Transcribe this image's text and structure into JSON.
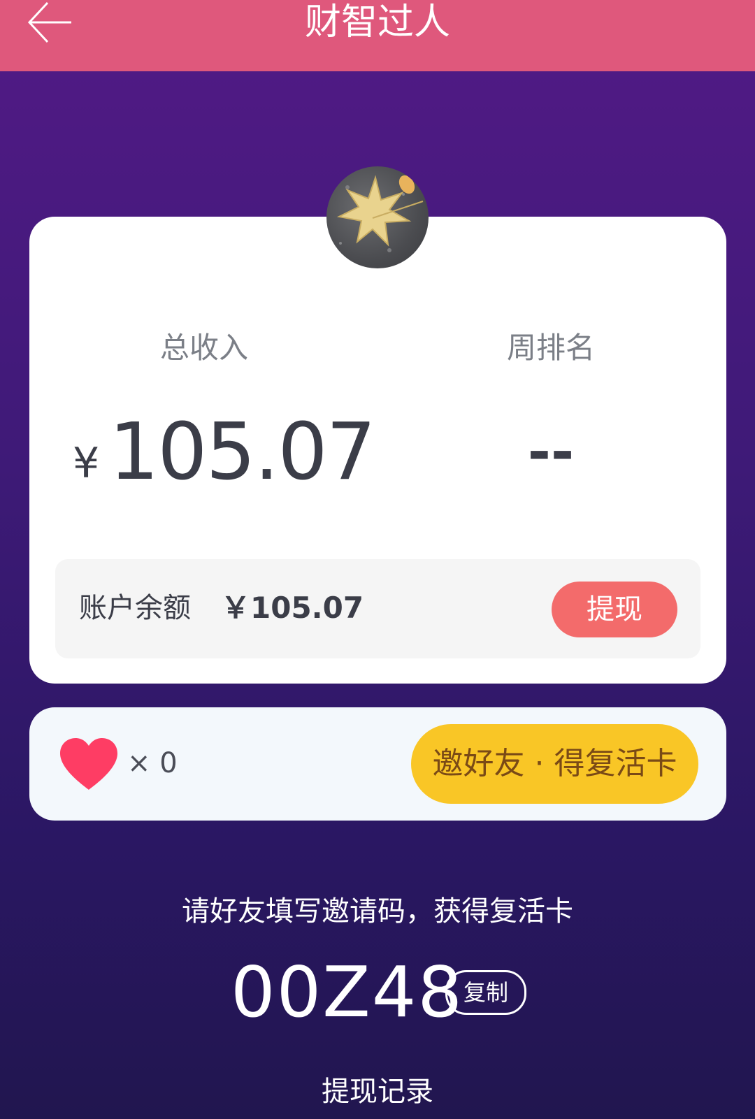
{
  "header": {
    "title": "财智过人",
    "back_icon": "arrow-left-icon"
  },
  "profile": {
    "avatar": "maple-leaf-photo"
  },
  "stats": {
    "income_label": "总收入",
    "income_currency": "¥",
    "income_value": "105.07",
    "rank_label": "周排名",
    "rank_value": "--"
  },
  "balance": {
    "label": "账户余额",
    "value": "￥105.07",
    "withdraw_label": "提现"
  },
  "revive": {
    "icon": "heart-icon",
    "count": "× 0",
    "invite_button_label": "邀好友 · 得复活卡"
  },
  "invite": {
    "hint": "请好友填写邀请码，获得复活卡",
    "code": "00Z48",
    "copy_label": "复制"
  },
  "footer": {
    "history_link": "提现记录"
  },
  "colors": {
    "header_bg": "#df587c",
    "page_bg_top": "#521a86",
    "page_bg_bottom": "#21164f",
    "withdraw_btn": "#f36b6b",
    "invite_btn": "#f9c626",
    "heart": "#fe3d64"
  }
}
